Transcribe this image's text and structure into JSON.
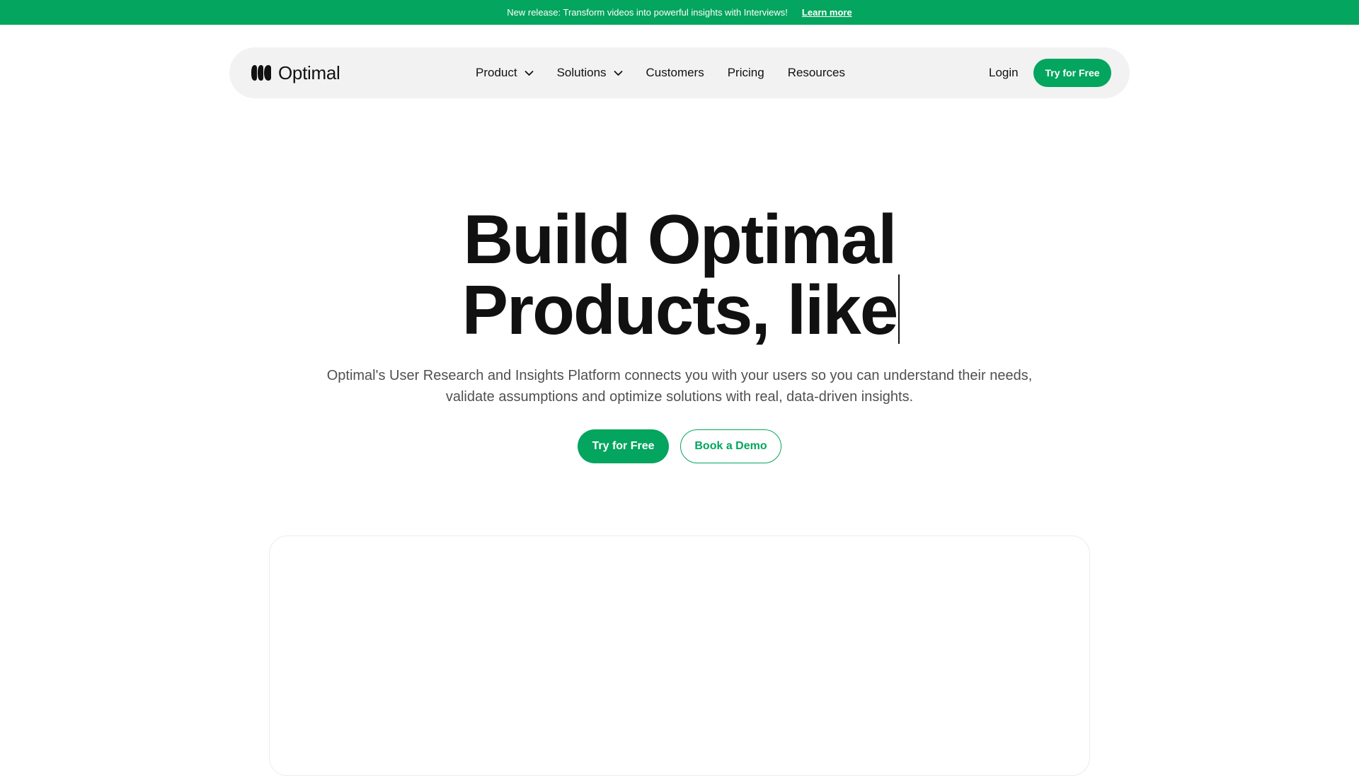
{
  "announcement": {
    "text": "New release: Transform videos into powerful insights with Interviews!",
    "link_label": "Learn more"
  },
  "nav": {
    "logo_text": "Optimal",
    "items": [
      {
        "label": "Product",
        "dropdown": true
      },
      {
        "label": "Solutions",
        "dropdown": true
      },
      {
        "label": "Customers",
        "dropdown": false
      },
      {
        "label": "Pricing",
        "dropdown": false
      },
      {
        "label": "Resources",
        "dropdown": false
      }
    ],
    "login_label": "Login",
    "cta_label": "Try for Free"
  },
  "hero": {
    "title_line1": "Build Optimal",
    "title_line2": "Products, like",
    "subtitle_line1": "Optimal's User Research and Insights Platform connects you with your users so you can understand their needs,",
    "subtitle_line2": "validate assumptions and optimize solutions with real, data-driven insights.",
    "primary_cta": "Try for Free",
    "secondary_cta": "Book a Demo"
  },
  "colors": {
    "brand_green": "#04a55e",
    "nav_background": "#f2f2f2",
    "text_primary": "#111111",
    "text_secondary": "#505050"
  },
  "icons": {
    "logo": "optimal-logo-icon",
    "dropdown": "chevron-down-icon"
  }
}
